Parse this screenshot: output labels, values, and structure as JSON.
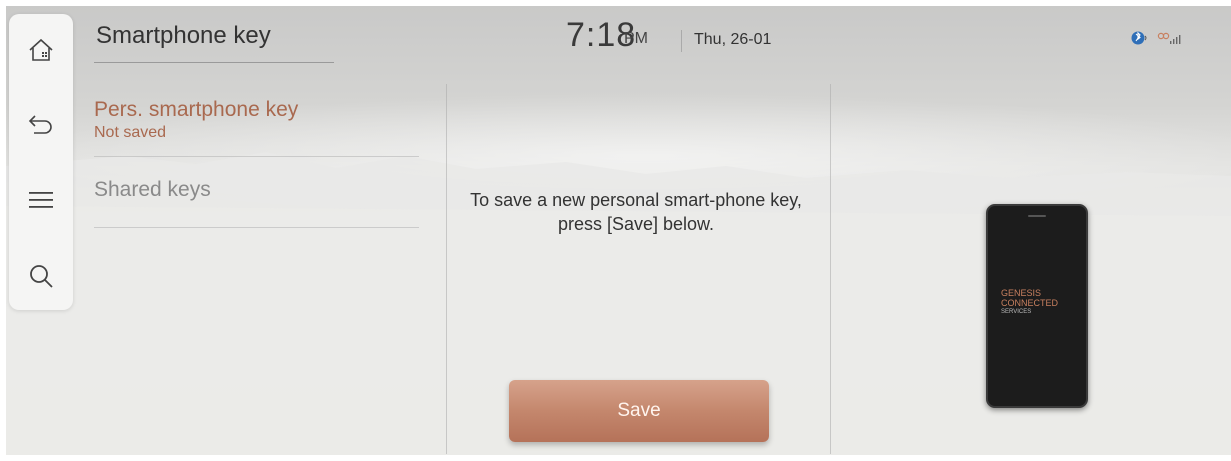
{
  "header": {
    "title": "Smartphone key",
    "time": "7:18",
    "ampm": "PM",
    "date": "Thu, 26-01"
  },
  "rail": {
    "icons": [
      "home-icon",
      "back-icon",
      "menu-icon",
      "search-icon"
    ]
  },
  "menu": {
    "items": [
      {
        "label": "Pers. smartphone key",
        "sublabel": "Not saved",
        "selected": true
      },
      {
        "label": "Shared keys",
        "selected": false
      }
    ]
  },
  "content": {
    "message": "To save a new personal smart-phone key, press [Save] below.",
    "save_label": "Save"
  },
  "phone": {
    "line1": "GENESIS",
    "line2": "CONNECTED",
    "line3": "SERVICES"
  },
  "colors": {
    "accent": "#b9785f",
    "selected_text": "#a9694f"
  }
}
